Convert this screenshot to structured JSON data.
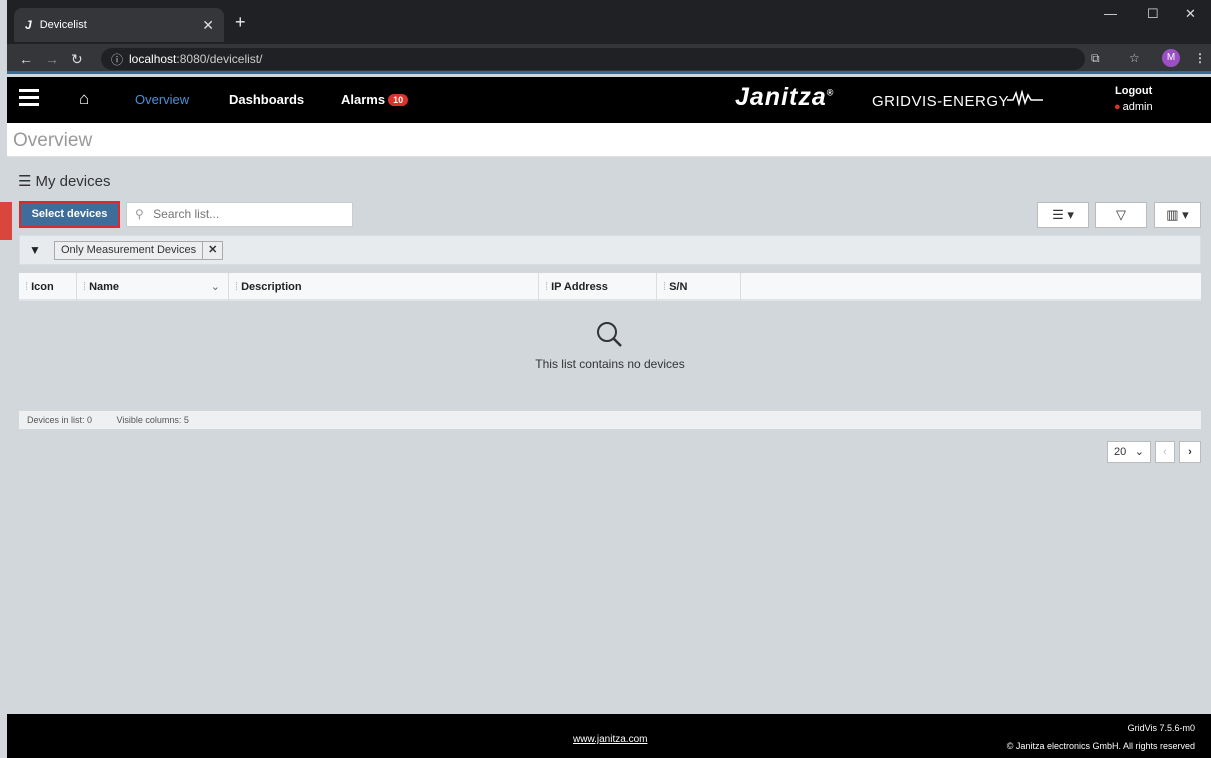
{
  "browser": {
    "tab_title": "Devicelist",
    "tab_favicon": "J",
    "url_host": "localhost",
    "url_rest": ":8080/devicelist/",
    "profile_initial": "M"
  },
  "header": {
    "nav_overview": "Overview",
    "nav_dashboards": "Dashboards",
    "nav_alarms": "Alarms",
    "alarm_count": "10",
    "brand": "Janitza",
    "brand_sub": "GRIDVIS-ENERGY",
    "logout": "Logout",
    "user": "admin"
  },
  "page": {
    "title": "Overview",
    "section_title": "My devices",
    "select_devices_label": "Select devices",
    "search_placeholder": "Search list...",
    "filter_chip": "Only Measurement Devices",
    "columns": [
      "Icon",
      "Name",
      "Description",
      "IP Address",
      "S/N"
    ],
    "empty_message": "This list contains no devices",
    "devices_in_list": "Devices in list: 0",
    "visible_columns": "Visible columns: 5",
    "page_size": "20"
  },
  "footer": {
    "link": "www.janitza.com",
    "version": "GridVis 7.5.6-m0",
    "copyright": "© Janitza electronics GmbH. All rights reserved"
  },
  "colors": {
    "accent": "#3e6d9c",
    "highlight": "#d92b2b",
    "badge": "#d9342b",
    "nav_active": "#4a90d9"
  }
}
